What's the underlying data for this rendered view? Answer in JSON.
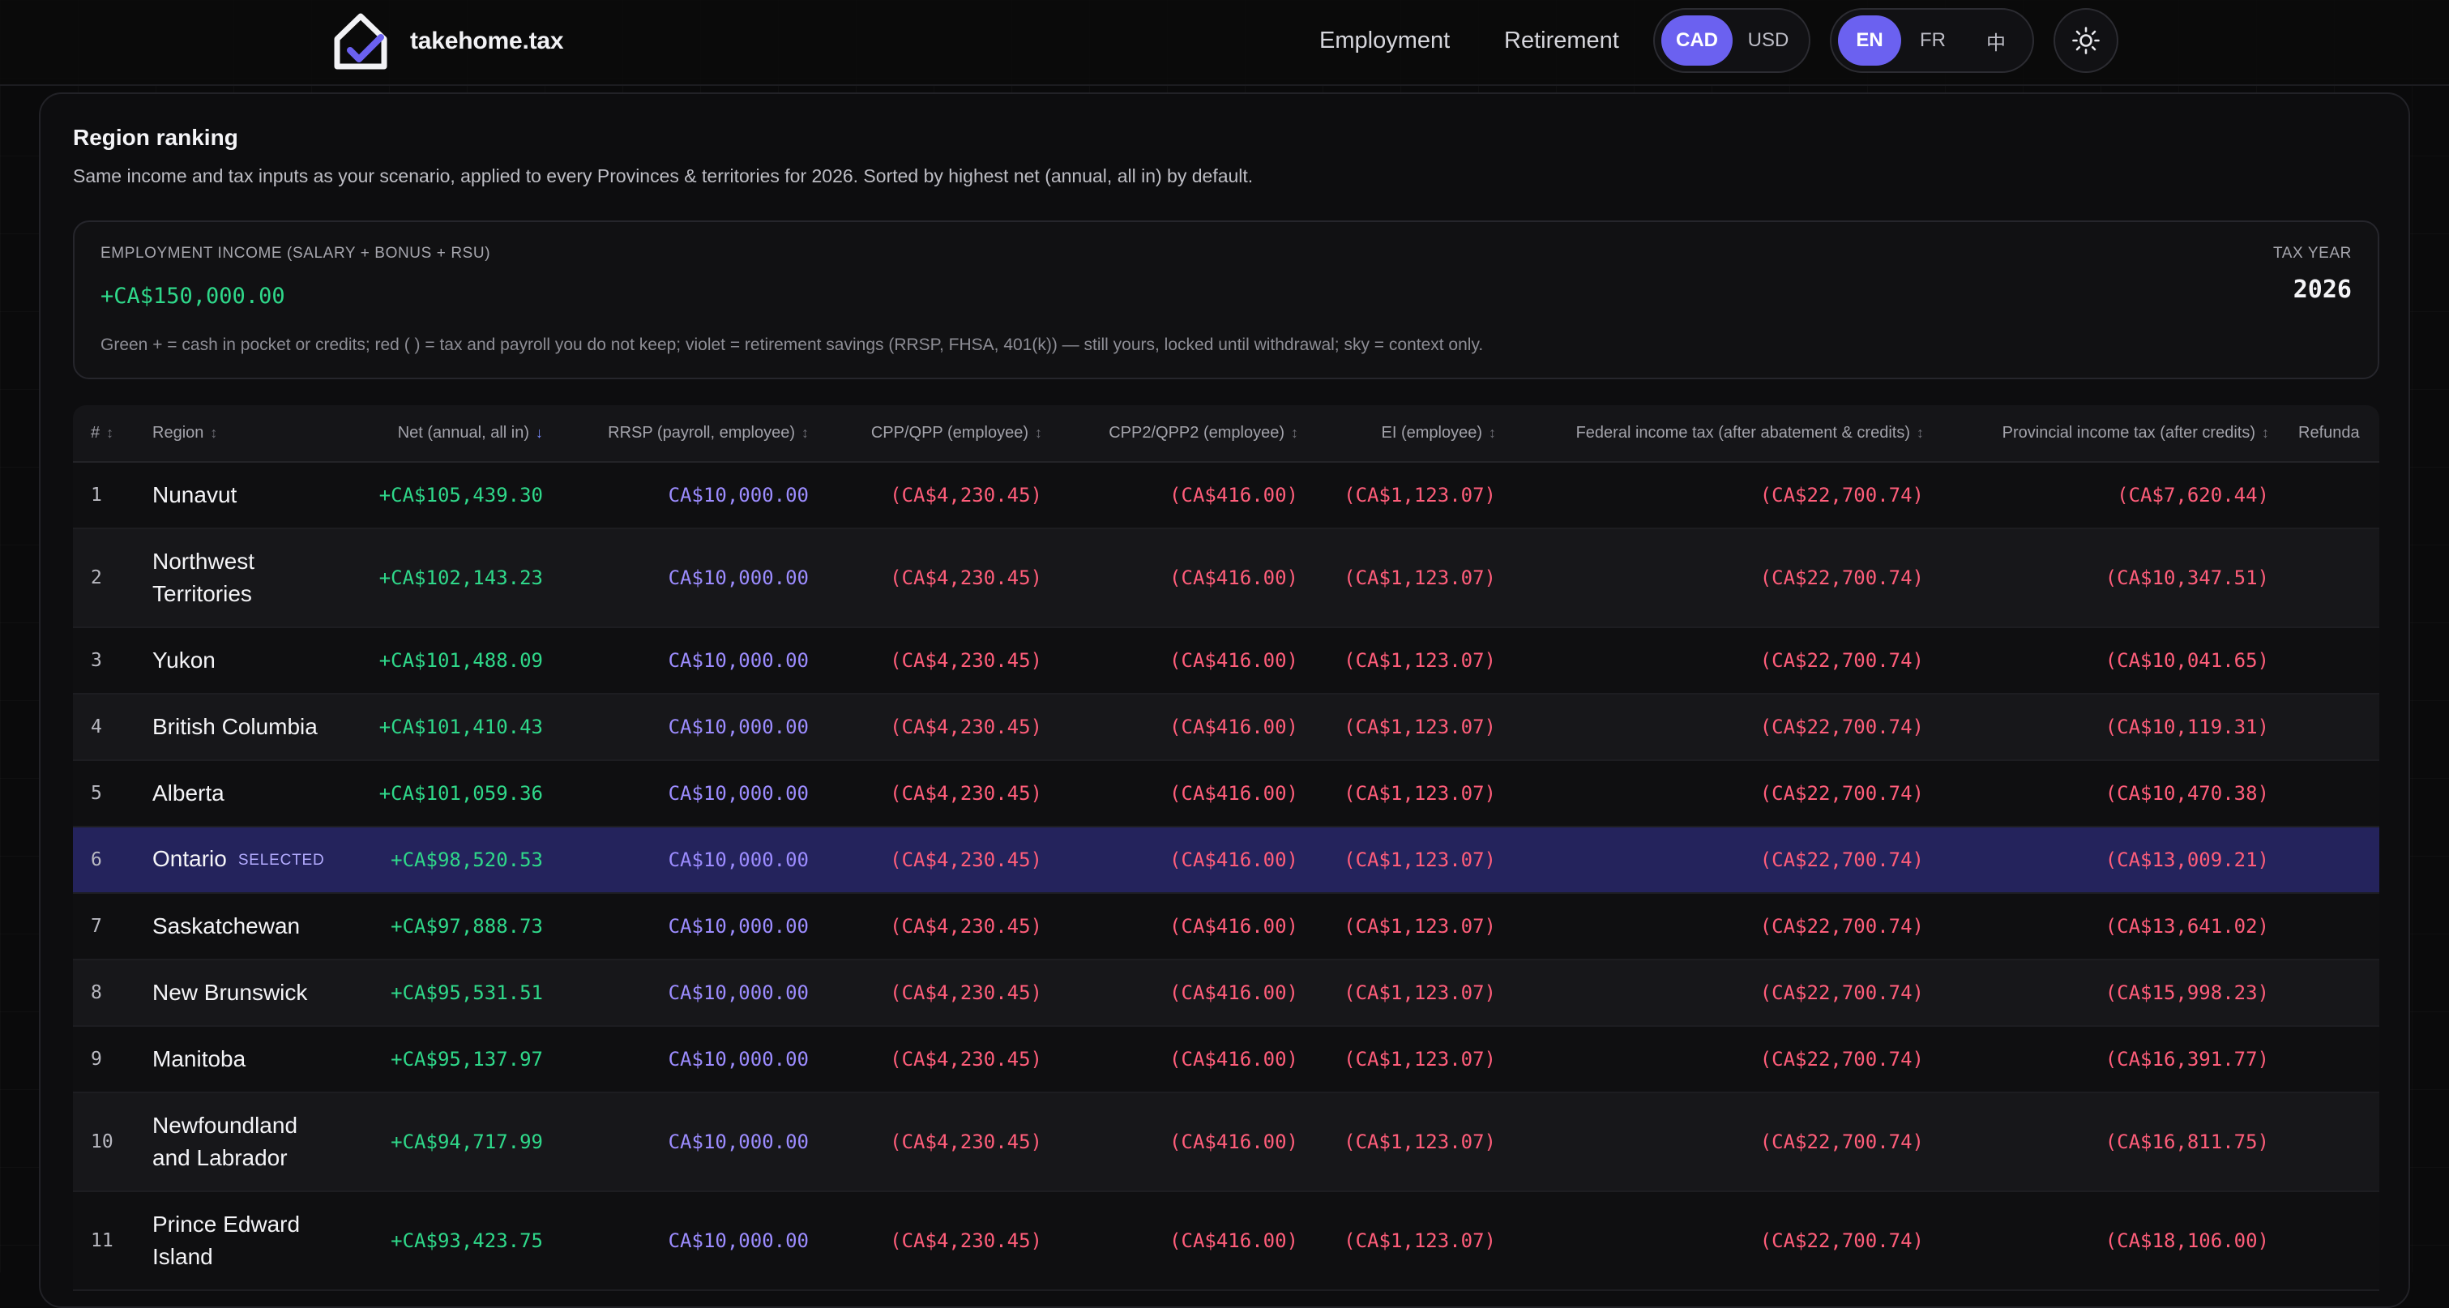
{
  "brand": {
    "name": "takehome.tax"
  },
  "nav": {
    "employment": "Employment",
    "retirement": "Retirement"
  },
  "currency": {
    "options": [
      "CAD",
      "USD"
    ],
    "selected": "CAD"
  },
  "language": {
    "options": [
      "EN",
      "FR",
      "中"
    ],
    "selected": "EN"
  },
  "theme_toggle": {
    "icon": "sun-icon"
  },
  "card": {
    "title": "Region ranking",
    "subtitle": "Same income and tax inputs as your scenario, applied to every Provinces & territories for 2026. Sorted by highest net (annual, all in) by default."
  },
  "inputs": {
    "income_label": "EMPLOYMENT INCOME (SALARY + BONUS + RSU)",
    "income_value": "+CA$150,000.00",
    "legend": "Green + = cash in pocket or credits; red ( ) = tax and payroll you do not keep; violet = retirement savings (RRSP, FHSA, 401(k)) — still yours, locked until withdrawal; sky = context only.",
    "tax_year_label": "TAX YEAR",
    "tax_year_value": "2026"
  },
  "table": {
    "columns": [
      {
        "label": "#",
        "sort": "none"
      },
      {
        "label": "Region",
        "sort": "none"
      },
      {
        "label": "Net (annual, all in)",
        "sort": "desc"
      },
      {
        "label": "RRSP (payroll, employee)",
        "sort": "none"
      },
      {
        "label": "CPP/QPP (employee)",
        "sort": "none"
      },
      {
        "label": "CPP2/QPP2 (employee)",
        "sort": "none"
      },
      {
        "label": "EI (employee)",
        "sort": "none"
      },
      {
        "label": "Federal income tax (after abatement & credits)",
        "sort": "none"
      },
      {
        "label": "Provincial income tax (after credits)",
        "sort": "none"
      },
      {
        "label": "Refunda",
        "sort": "none"
      }
    ],
    "selected_badge": "SELECTED",
    "rows": [
      {
        "rank": "1",
        "region": "Nunavut",
        "net": "+CA$105,439.30",
        "rrsp": "CA$10,000.00",
        "cpp": "(CA$4,230.45)",
        "cpp2": "(CA$416.00)",
        "ei": "(CA$1,123.07)",
        "federal": "(CA$22,700.74)",
        "provincial": "(CA$7,620.44)"
      },
      {
        "rank": "2",
        "region": "Northwest Territories",
        "net": "+CA$102,143.23",
        "rrsp": "CA$10,000.00",
        "cpp": "(CA$4,230.45)",
        "cpp2": "(CA$416.00)",
        "ei": "(CA$1,123.07)",
        "federal": "(CA$22,700.74)",
        "provincial": "(CA$10,347.51)"
      },
      {
        "rank": "3",
        "region": "Yukon",
        "net": "+CA$101,488.09",
        "rrsp": "CA$10,000.00",
        "cpp": "(CA$4,230.45)",
        "cpp2": "(CA$416.00)",
        "ei": "(CA$1,123.07)",
        "federal": "(CA$22,700.74)",
        "provincial": "(CA$10,041.65)"
      },
      {
        "rank": "4",
        "region": "British Columbia",
        "net": "+CA$101,410.43",
        "rrsp": "CA$10,000.00",
        "cpp": "(CA$4,230.45)",
        "cpp2": "(CA$416.00)",
        "ei": "(CA$1,123.07)",
        "federal": "(CA$22,700.74)",
        "provincial": "(CA$10,119.31)"
      },
      {
        "rank": "5",
        "region": "Alberta",
        "net": "+CA$101,059.36",
        "rrsp": "CA$10,000.00",
        "cpp": "(CA$4,230.45)",
        "cpp2": "(CA$416.00)",
        "ei": "(CA$1,123.07)",
        "federal": "(CA$22,700.74)",
        "provincial": "(CA$10,470.38)"
      },
      {
        "rank": "6",
        "region": "Ontario",
        "net": "+CA$98,520.53",
        "rrsp": "CA$10,000.00",
        "cpp": "(CA$4,230.45)",
        "cpp2": "(CA$416.00)",
        "ei": "(CA$1,123.07)",
        "federal": "(CA$22,700.74)",
        "provincial": "(CA$13,009.21)"
      },
      {
        "rank": "7",
        "region": "Saskatchewan",
        "net": "+CA$97,888.73",
        "rrsp": "CA$10,000.00",
        "cpp": "(CA$4,230.45)",
        "cpp2": "(CA$416.00)",
        "ei": "(CA$1,123.07)",
        "federal": "(CA$22,700.74)",
        "provincial": "(CA$13,641.02)"
      },
      {
        "rank": "8",
        "region": "New Brunswick",
        "net": "+CA$95,531.51",
        "rrsp": "CA$10,000.00",
        "cpp": "(CA$4,230.45)",
        "cpp2": "(CA$416.00)",
        "ei": "(CA$1,123.07)",
        "federal": "(CA$22,700.74)",
        "provincial": "(CA$15,998.23)"
      },
      {
        "rank": "9",
        "region": "Manitoba",
        "net": "+CA$95,137.97",
        "rrsp": "CA$10,000.00",
        "cpp": "(CA$4,230.45)",
        "cpp2": "(CA$416.00)",
        "ei": "(CA$1,123.07)",
        "federal": "(CA$22,700.74)",
        "provincial": "(CA$16,391.77)"
      },
      {
        "rank": "10",
        "region": "Newfoundland and Labrador",
        "net": "+CA$94,717.99",
        "rrsp": "CA$10,000.00",
        "cpp": "(CA$4,230.45)",
        "cpp2": "(CA$416.00)",
        "ei": "(CA$1,123.07)",
        "federal": "(CA$22,700.74)",
        "provincial": "(CA$16,811.75)"
      },
      {
        "rank": "11",
        "region": "Prince Edward Island",
        "net": "+CA$93,423.75",
        "rrsp": "CA$10,000.00",
        "cpp": "(CA$4,230.45)",
        "cpp2": "(CA$416.00)",
        "ei": "(CA$1,123.07)",
        "federal": "(CA$22,700.74)",
        "provincial": "(CA$18,106.00)"
      }
    ]
  },
  "colors": {
    "accent": "#6b61f0",
    "positive": "#2fd88a",
    "retirement": "#9c8cff",
    "negative": "#ff5d7a",
    "selected_row": "#24235c"
  }
}
